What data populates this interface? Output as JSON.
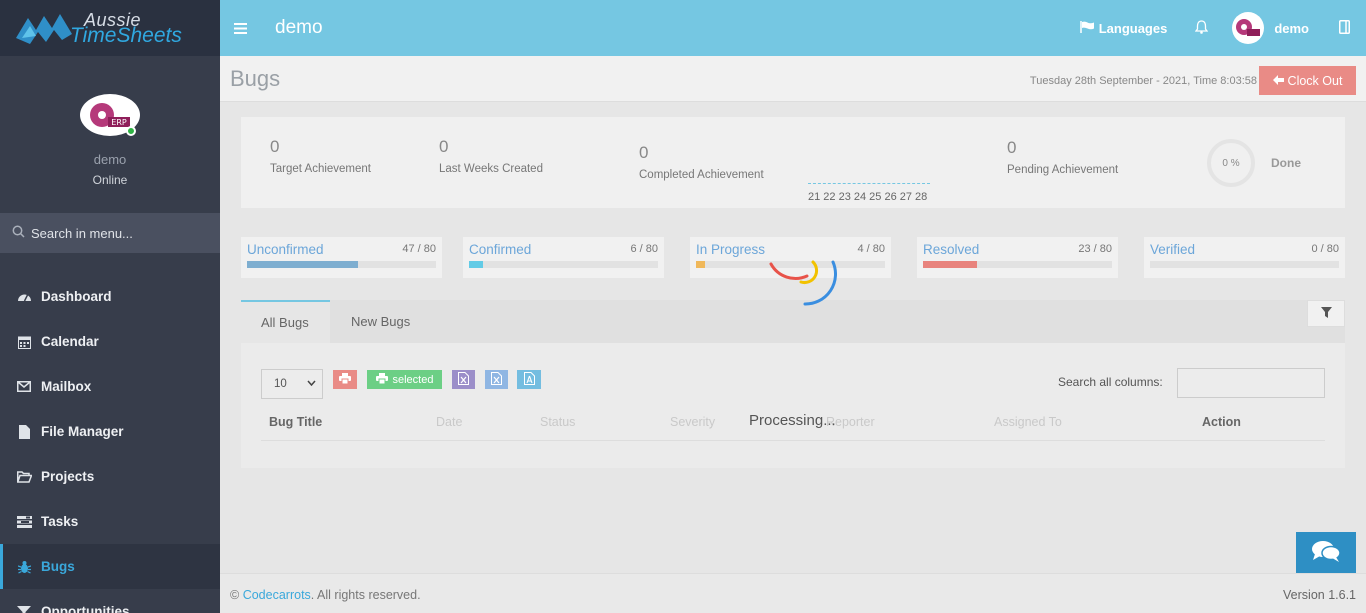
{
  "brand": {
    "line1": "Aussie",
    "line2": "TimeSheets"
  },
  "profile": {
    "name": "demo",
    "status": "Online",
    "avatar_text": "ERP"
  },
  "sidebar": {
    "search_placeholder": "Search in menu...",
    "items": [
      {
        "label": "Dashboard",
        "icon": "dashboard-icon"
      },
      {
        "label": "Calendar",
        "icon": "calendar-icon"
      },
      {
        "label": "Mailbox",
        "icon": "envelope-icon"
      },
      {
        "label": "File Manager",
        "icon": "file-icon"
      },
      {
        "label": "Projects",
        "icon": "folder-icon"
      },
      {
        "label": "Tasks",
        "icon": "tasks-icon"
      },
      {
        "label": "Bugs",
        "icon": "bug-icon"
      },
      {
        "label": "Opportunities",
        "icon": "opportunity-icon"
      }
    ],
    "active_index": 6
  },
  "topbar": {
    "title": "demo",
    "languages": "Languages",
    "user": "demo"
  },
  "page": {
    "title": "Bugs",
    "datetime": "Tuesday 28th September - 2021,  Time  8:03:58",
    "clockout": "Clock Out"
  },
  "stats": {
    "target": {
      "value": "0",
      "label": "Target Achievement"
    },
    "last_weeks": {
      "value": "0",
      "label": "Last Weeks Created"
    },
    "completed": {
      "value": "0",
      "label": "Completed Achievement"
    },
    "pending": {
      "value": "0",
      "label": "Pending Achievement"
    },
    "days": "21 22 23 24 25 26 27 28",
    "donut_pct": "0 %",
    "done_label": "Done"
  },
  "status_cards": [
    {
      "title": "Unconfirmed",
      "count": "47 / 80",
      "fraction": 0.5875,
      "color": "#7eaed0"
    },
    {
      "title": "Confirmed",
      "count": "6 / 80",
      "fraction": 0.075,
      "color": "#62cbe6"
    },
    {
      "title": "In Progress",
      "count": "4 / 80",
      "fraction": 0.05,
      "color": "#f0b85a"
    },
    {
      "title": "Resolved",
      "count": "23 / 80",
      "fraction": 0.2875,
      "color": "#e8837d"
    },
    {
      "title": "Verified",
      "count": "0 / 80",
      "fraction": 0,
      "color": "#7eaed0"
    }
  ],
  "tabs": {
    "all": "All Bugs",
    "new": "New Bugs"
  },
  "table": {
    "page_size": "10",
    "selected_label": "selected",
    "search_label": "Search all columns:",
    "processing": "Processing...",
    "headers": [
      "Bug Title",
      "Date",
      "Status",
      "Severity",
      "Reporter",
      "Assigned To",
      "Action"
    ]
  },
  "footer": {
    "brand": "Codecarrots",
    "rights": ". All rights reserved.",
    "copyright": "©",
    "version": "Version 1.6.1"
  }
}
